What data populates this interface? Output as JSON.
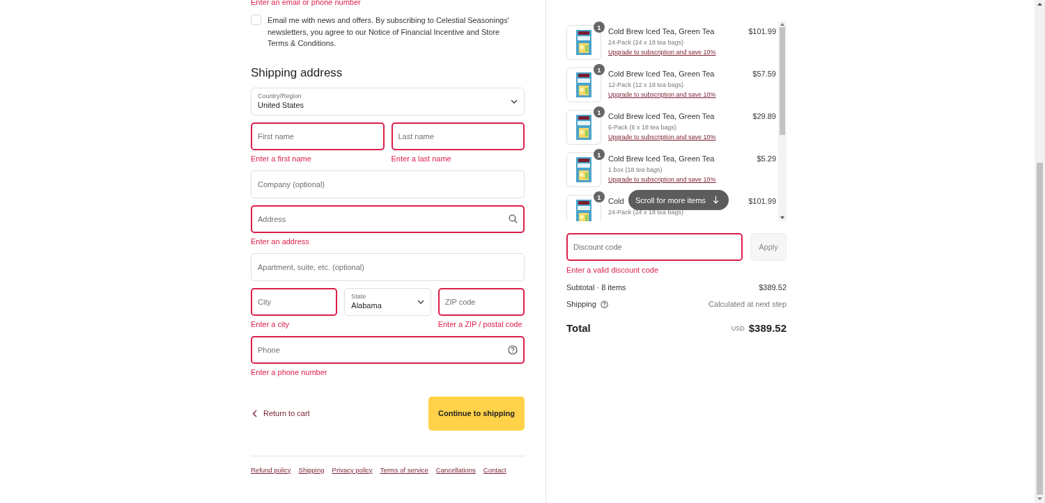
{
  "top_error": "Enter an email or phone number",
  "newsletter": {
    "checked": false,
    "label": "Email me with news and offers. By subscribing to Celestial Seasonings' newsletters, you agree to our Notice of Financial Incentive and Store Terms & Conditions."
  },
  "shipping_address": {
    "heading": "Shipping address",
    "rows": [
      [
        {
          "kind": "select",
          "label": "Country/Region",
          "value": "United States"
        }
      ],
      [
        {
          "kind": "text",
          "placeholder": "First name",
          "error": "Enter a first name"
        },
        {
          "kind": "text",
          "placeholder": "Last name",
          "error": "Enter a last name"
        }
      ],
      [
        {
          "kind": "text",
          "placeholder": "Company (optional)"
        }
      ],
      [
        {
          "kind": "search",
          "placeholder": "Address",
          "error": "Enter an address"
        }
      ],
      [
        {
          "kind": "text",
          "placeholder": "Apartment, suite, etc. (optional)"
        }
      ],
      [
        {
          "kind": "text",
          "placeholder": "City",
          "error": "Enter a city"
        },
        {
          "kind": "select",
          "label": "State",
          "value": "Alabama"
        },
        {
          "kind": "text",
          "placeholder": "ZIP code",
          "error": "Enter a ZIP / postal code"
        }
      ],
      [
        {
          "kind": "help",
          "placeholder": "Phone",
          "error": "Enter a phone number"
        }
      ]
    ]
  },
  "actions": {
    "back": "Return to cart",
    "continue": "Continue to shipping"
  },
  "footer_links": [
    "Refund policy",
    "Shipping",
    "Privacy policy",
    "Terms of service",
    "Cancellations",
    "Contact"
  ],
  "order_items": [
    {
      "quantity": "1",
      "name": "Cold Brew Iced Tea, Green Tea",
      "variant": "24-Pack (24 x 18 tea bags)",
      "upgrade": "Upgrade to subscription and save 10%",
      "price": "$101.99"
    },
    {
      "quantity": "1",
      "name": "Cold Brew Iced Tea, Green Tea",
      "variant": "12-Pack (12 x 18 tea bags)",
      "upgrade": "Upgrade to subscription and save 10%",
      "price": "$57.59"
    },
    {
      "quantity": "1",
      "name": "Cold Brew Iced Tea, Green Tea",
      "variant": "6-Pack (6 x 18 tea bags)",
      "upgrade": "Upgrade to subscription and save 10%",
      "price": "$29.89"
    },
    {
      "quantity": "1",
      "name": "Cold Brew Iced Tea, Green Tea",
      "variant": "1 box (18 tea bags)",
      "upgrade": "Upgrade to subscription and save 10%",
      "price": "$5.29"
    },
    {
      "quantity": "1",
      "name": "Cold",
      "variant": "24-Pack (24 x 18 tea bags)",
      "price": "$101.99"
    }
  ],
  "scroll_hint": "Scroll for more items",
  "discount": {
    "placeholder": "Discount code",
    "button": "Apply",
    "error": "Enter a valid discount code"
  },
  "summary": {
    "subtotal_label": "Subtotal · 8 items",
    "subtotal": "$389.52",
    "shipping_label": "Shipping",
    "shipping": "Calculated at next step",
    "total_label": "Total",
    "currency": "USD",
    "total": "$389.52"
  }
}
